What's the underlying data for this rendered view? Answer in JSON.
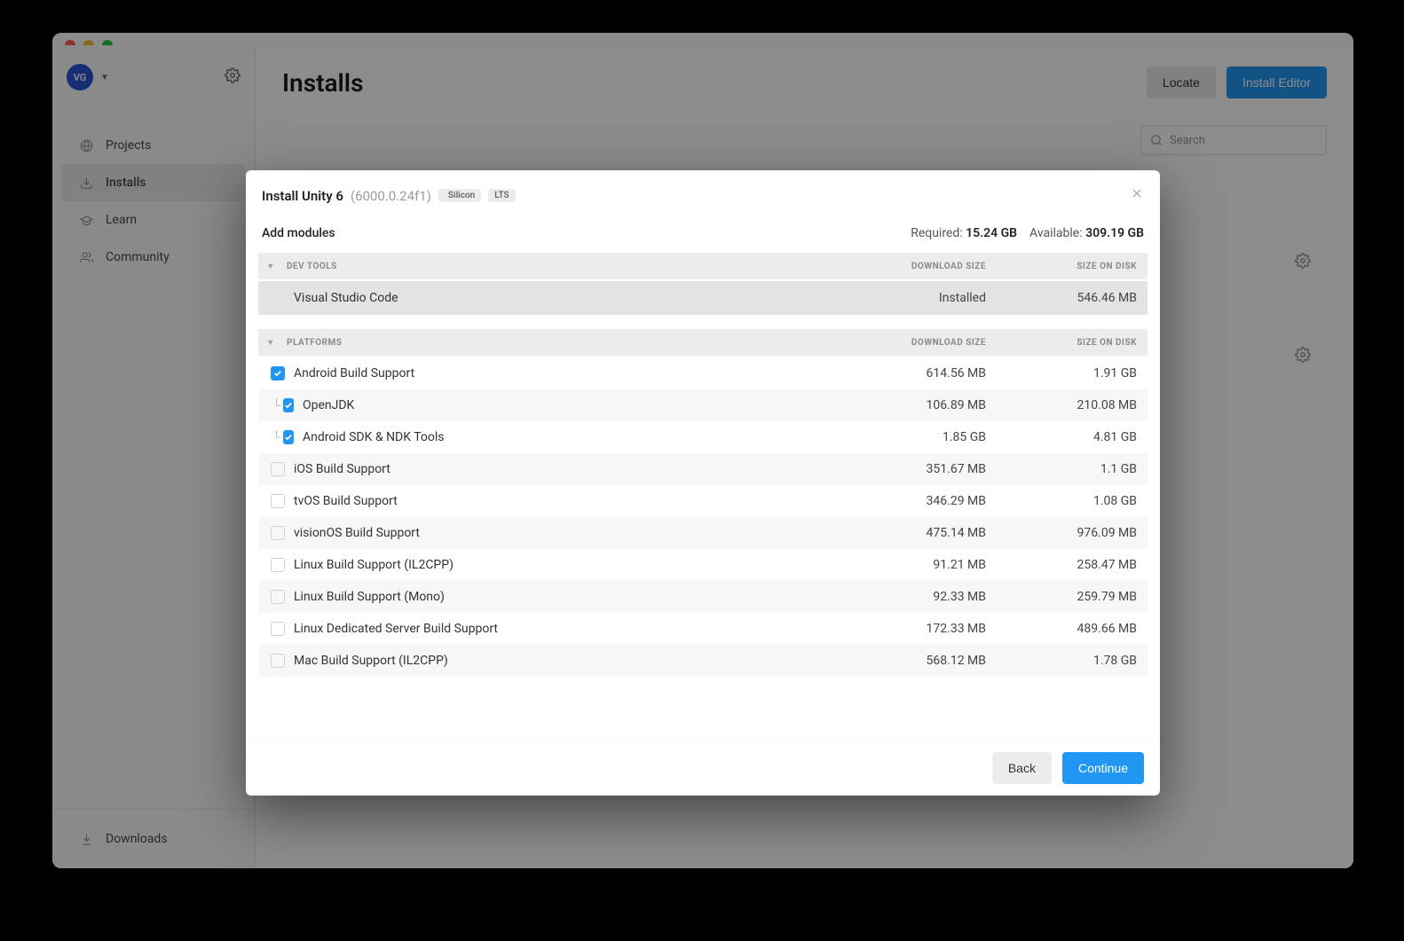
{
  "window": {
    "user_initials": "VG"
  },
  "sidebar": {
    "items": [
      {
        "label": "Projects",
        "icon": "globe"
      },
      {
        "label": "Installs",
        "icon": "download",
        "active": true
      },
      {
        "label": "Learn",
        "icon": "graduation"
      },
      {
        "label": "Community",
        "icon": "people"
      }
    ],
    "downloads_label": "Downloads"
  },
  "main": {
    "title": "Installs",
    "locate_label": "Locate",
    "install_editor_label": "Install Editor",
    "search_placeholder": "Search"
  },
  "modal": {
    "title_prefix": "Install Unity 6",
    "version": "(6000.0.24f1)",
    "badge_silicon": "Silicon",
    "badge_lts": "LTS",
    "add_modules_label": "Add modules",
    "required_label": "Required:",
    "required_value": "15.24 GB",
    "available_label": "Available:",
    "available_value": "309.19 GB",
    "col_download": "DOWNLOAD SIZE",
    "col_disk": "SIZE ON DISK",
    "section_devtools": "DEV TOOLS",
    "section_platforms": "PLATFORMS",
    "devtools": [
      {
        "name": "Visual Studio Code",
        "download": "Installed",
        "disk": "546.46 MB",
        "installed": true
      }
    ],
    "platforms": [
      {
        "name": "Android Build Support",
        "download": "614.56 MB",
        "disk": "1.91 GB",
        "checked": true
      },
      {
        "name": "OpenJDK",
        "download": "106.89 MB",
        "disk": "210.08 MB",
        "checked": true,
        "child": true
      },
      {
        "name": "Android SDK & NDK Tools",
        "download": "1.85 GB",
        "disk": "4.81 GB",
        "checked": true,
        "child": true
      },
      {
        "name": "iOS Build Support",
        "download": "351.67 MB",
        "disk": "1.1 GB",
        "checked": false
      },
      {
        "name": "tvOS Build Support",
        "download": "346.29 MB",
        "disk": "1.08 GB",
        "checked": false
      },
      {
        "name": "visionOS Build Support",
        "download": "475.14 MB",
        "disk": "976.09 MB",
        "checked": false
      },
      {
        "name": "Linux Build Support (IL2CPP)",
        "download": "91.21 MB",
        "disk": "258.47 MB",
        "checked": false
      },
      {
        "name": "Linux Build Support (Mono)",
        "download": "92.33 MB",
        "disk": "259.79 MB",
        "checked": false
      },
      {
        "name": "Linux Dedicated Server Build Support",
        "download": "172.33 MB",
        "disk": "489.66 MB",
        "checked": false
      },
      {
        "name": "Mac Build Support (IL2CPP)",
        "download": "568.12 MB",
        "disk": "1.78 GB",
        "checked": false
      }
    ],
    "back_label": "Back",
    "continue_label": "Continue"
  }
}
